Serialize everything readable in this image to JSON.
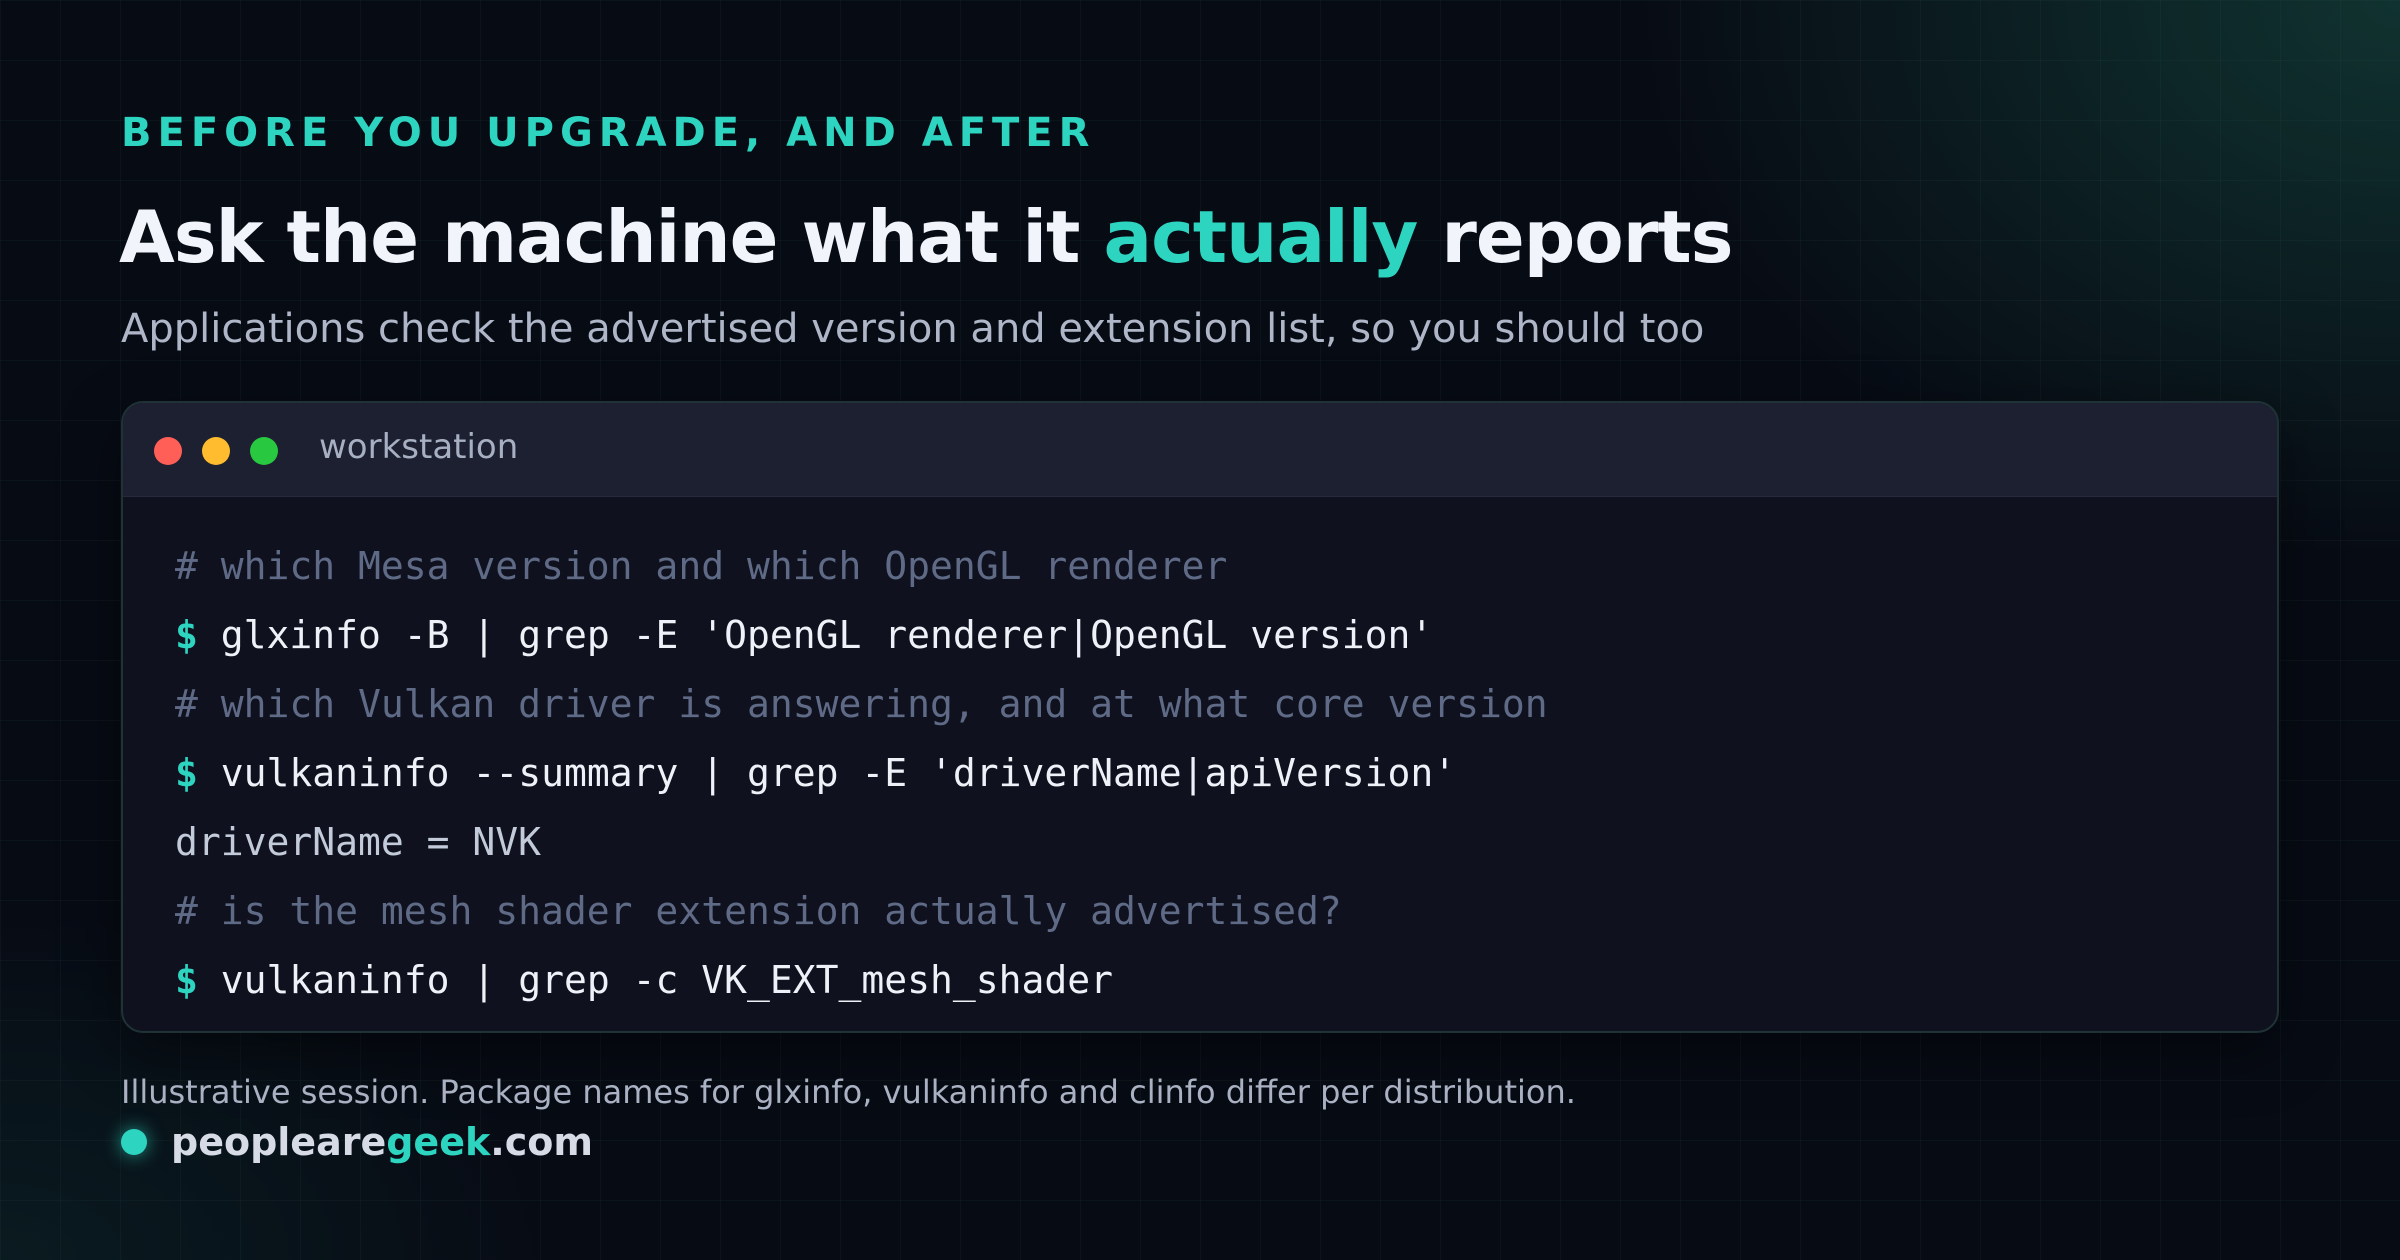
{
  "header": {
    "eyebrow": "BEFORE YOU UPGRADE, AND AFTER",
    "title_before": "Ask the machine what it ",
    "title_accent": "actually",
    "title_after": " reports",
    "subtitle": "Applications check the advertised version and extension list, so you should too"
  },
  "terminal": {
    "window_title": "workstation",
    "prompt_symbol": "$",
    "lines": [
      {
        "kind": "comment",
        "text": "# which Mesa version and which OpenGL renderer"
      },
      {
        "kind": "command",
        "text": "glxinfo -B | grep -E 'OpenGL renderer|OpenGL version'"
      },
      {
        "kind": "comment",
        "text": "# which Vulkan driver is answering, and at what core version"
      },
      {
        "kind": "command",
        "text": "vulkaninfo --summary | grep -E 'driverName|apiVersion'"
      },
      {
        "kind": "output",
        "text": "driverName = NVK"
      },
      {
        "kind": "comment",
        "text": "# is the mesh shader extension actually advertised?"
      },
      {
        "kind": "command",
        "text": "vulkaninfo | grep -c VK_EXT_mesh_shader"
      }
    ]
  },
  "footer": {
    "note": "Illustrative session. Package names for glxinfo, vulkaninfo and clinfo differ per distribution.",
    "brand_before": "peopleare",
    "brand_accent": "geek",
    "brand_after": ".com"
  },
  "colors": {
    "accent": "#2dd4bf",
    "background": "#070b14",
    "terminal_bg": "#0f121e",
    "titlebar_bg": "#1d2030",
    "dot_red": "#ff5f57",
    "dot_yellow": "#febc2e",
    "dot_green": "#28c840"
  }
}
